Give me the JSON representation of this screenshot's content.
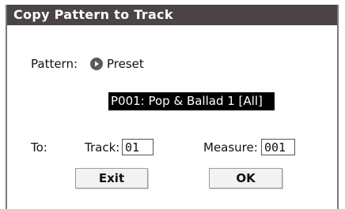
{
  "dialog": {
    "title": "Copy Pattern to Track"
  },
  "pattern": {
    "label": "Pattern:",
    "bank": "Preset",
    "selection": "P001: Pop & Ballad 1 [All]"
  },
  "destination": {
    "to_label": "To:",
    "track_label": "Track:",
    "track_value": "01",
    "measure_label": "Measure:",
    "measure_value": "001"
  },
  "buttons": {
    "exit_label": "Exit",
    "ok_label": "OK"
  }
}
